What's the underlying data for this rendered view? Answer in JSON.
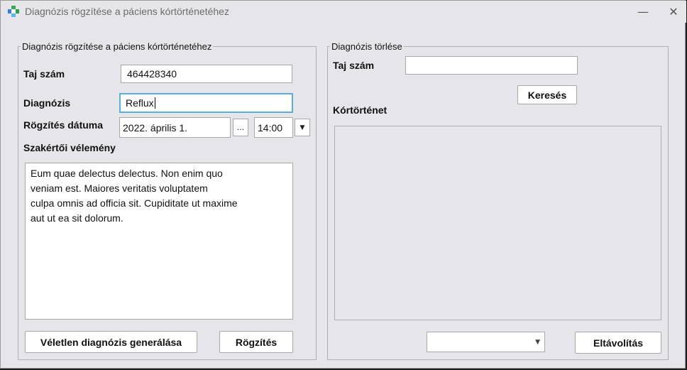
{
  "window": {
    "title": "Diagnózis rögzítése a páciens kórtörténetéhez",
    "minimize_glyph": "—",
    "close_glyph": "✕",
    "icon": "medical-cross-icon"
  },
  "record_panel": {
    "group_title": "Diagnózis rögzítése a páciens kórtörténetéhez",
    "taj_label": "Taj szám",
    "taj_value": "464428340",
    "diagnosis_label": "Diagnózis",
    "diagnosis_value": "Reflux",
    "date_label": "Rögzítés dátuma",
    "date_value": "2022. április 1.",
    "date_picker_glyph": "...",
    "time_value": "14:00",
    "time_dropdown_glyph": "▼",
    "opinion_label": "Szakértői vélemény",
    "opinion_lines": [
      "Eum quae delectus delectus. Non enim quo",
      "veniam est. Maiores veritatis voluptatem",
      "culpa omnis ad officia sit. Cupiditate ut maxime",
      "aut ut ea sit dolorum."
    ],
    "random_button": "Véletlen diagnózis generálása",
    "save_button": "Rögzítés"
  },
  "delete_panel": {
    "group_title": "Diagnózis törlése",
    "taj_label": "Taj szám",
    "taj_value": "",
    "search_button": "Keresés",
    "history_label": "Kórtörténet",
    "selector_value": "",
    "selector_glyph": "▼",
    "remove_button": "Eltávolítás"
  },
  "colors": {
    "window_bg": "#e6e6ea",
    "focus_border": "#5aaed9",
    "icon_green": "#2e9e48",
    "icon_blue": "#3b7fd9"
  }
}
